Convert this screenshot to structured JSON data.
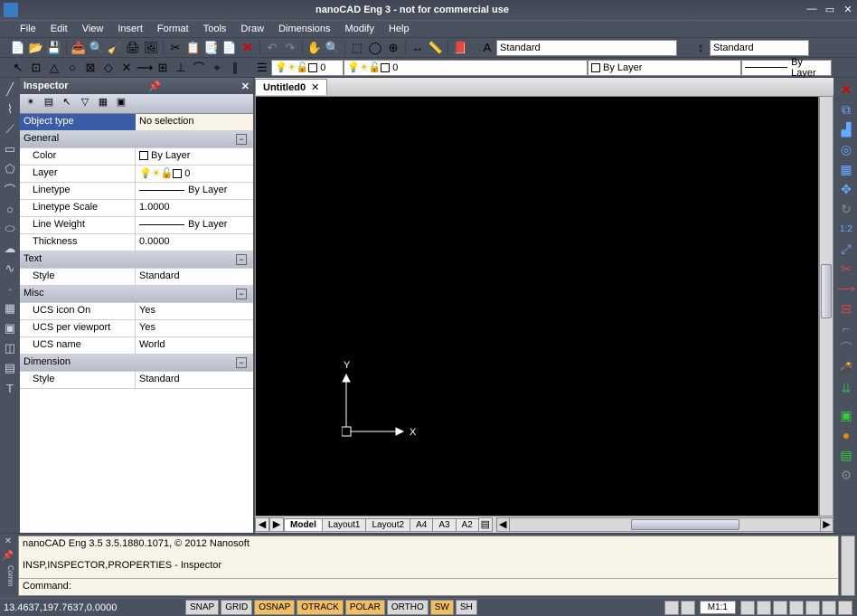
{
  "app": {
    "title": "nanoCAD Eng 3 - not for commercial use"
  },
  "menu": [
    "File",
    "Edit",
    "View",
    "Insert",
    "Format",
    "Tools",
    "Draw",
    "Dimensions",
    "Modify",
    "Help"
  ],
  "toolbar1": {
    "style1": "Standard",
    "style2": "Standard"
  },
  "toolbar2": {
    "layer_name": "0",
    "layer_combo": "0",
    "linetype": "By Layer",
    "lineweight": "By Layer"
  },
  "inspector": {
    "title": "Inspector",
    "object_type_label": "Object type",
    "object_type_value": "No selection",
    "sections": {
      "general": {
        "title": "General",
        "color_label": "Color",
        "color_value": "By Layer",
        "layer_label": "Layer",
        "layer_value": "0",
        "linetype_label": "Linetype",
        "linetype_value": "By Layer",
        "linetype_scale_label": "Linetype Scale",
        "linetype_scale_value": "1.0000",
        "lineweight_label": "Line Weight",
        "lineweight_value": "By Layer",
        "thickness_label": "Thickness",
        "thickness_value": "0.0000"
      },
      "text": {
        "title": "Text",
        "style_label": "Style",
        "style_value": "Standard"
      },
      "misc": {
        "title": "Misc",
        "ucs_icon_label": "UCS icon On",
        "ucs_icon_value": "Yes",
        "ucs_vp_label": "UCS per viewport",
        "ucs_vp_value": "Yes",
        "ucs_name_label": "UCS name",
        "ucs_name_value": "World"
      },
      "dimension": {
        "title": "Dimension",
        "style_label": "Style",
        "style_value": "Standard"
      }
    }
  },
  "doc": {
    "tab": "Untitled0",
    "layout_tabs": [
      "Model",
      "Layout1",
      "Layout2",
      "A4",
      "A3",
      "A2"
    ],
    "ucs": {
      "x": "X",
      "y": "Y"
    }
  },
  "cmd": {
    "about": "nanoCAD Eng 3.5 3.5.1880.1071, © 2012 Nanosoft",
    "hist": "INSP,INSPECTOR,PROPERTIES - Inspector",
    "prompt": "Command:"
  },
  "status": {
    "coords": "13.4637,197.7637,0.0000",
    "toggles": [
      {
        "label": "SNAP",
        "on": false
      },
      {
        "label": "GRID",
        "on": false
      },
      {
        "label": "OSNAP",
        "on": true
      },
      {
        "label": "OTRACK",
        "on": true
      },
      {
        "label": "POLAR",
        "on": true
      },
      {
        "label": "ORTHO",
        "on": false
      },
      {
        "label": "SW",
        "on": true
      },
      {
        "label": "SH",
        "on": false
      }
    ],
    "scale": "M1:1"
  }
}
